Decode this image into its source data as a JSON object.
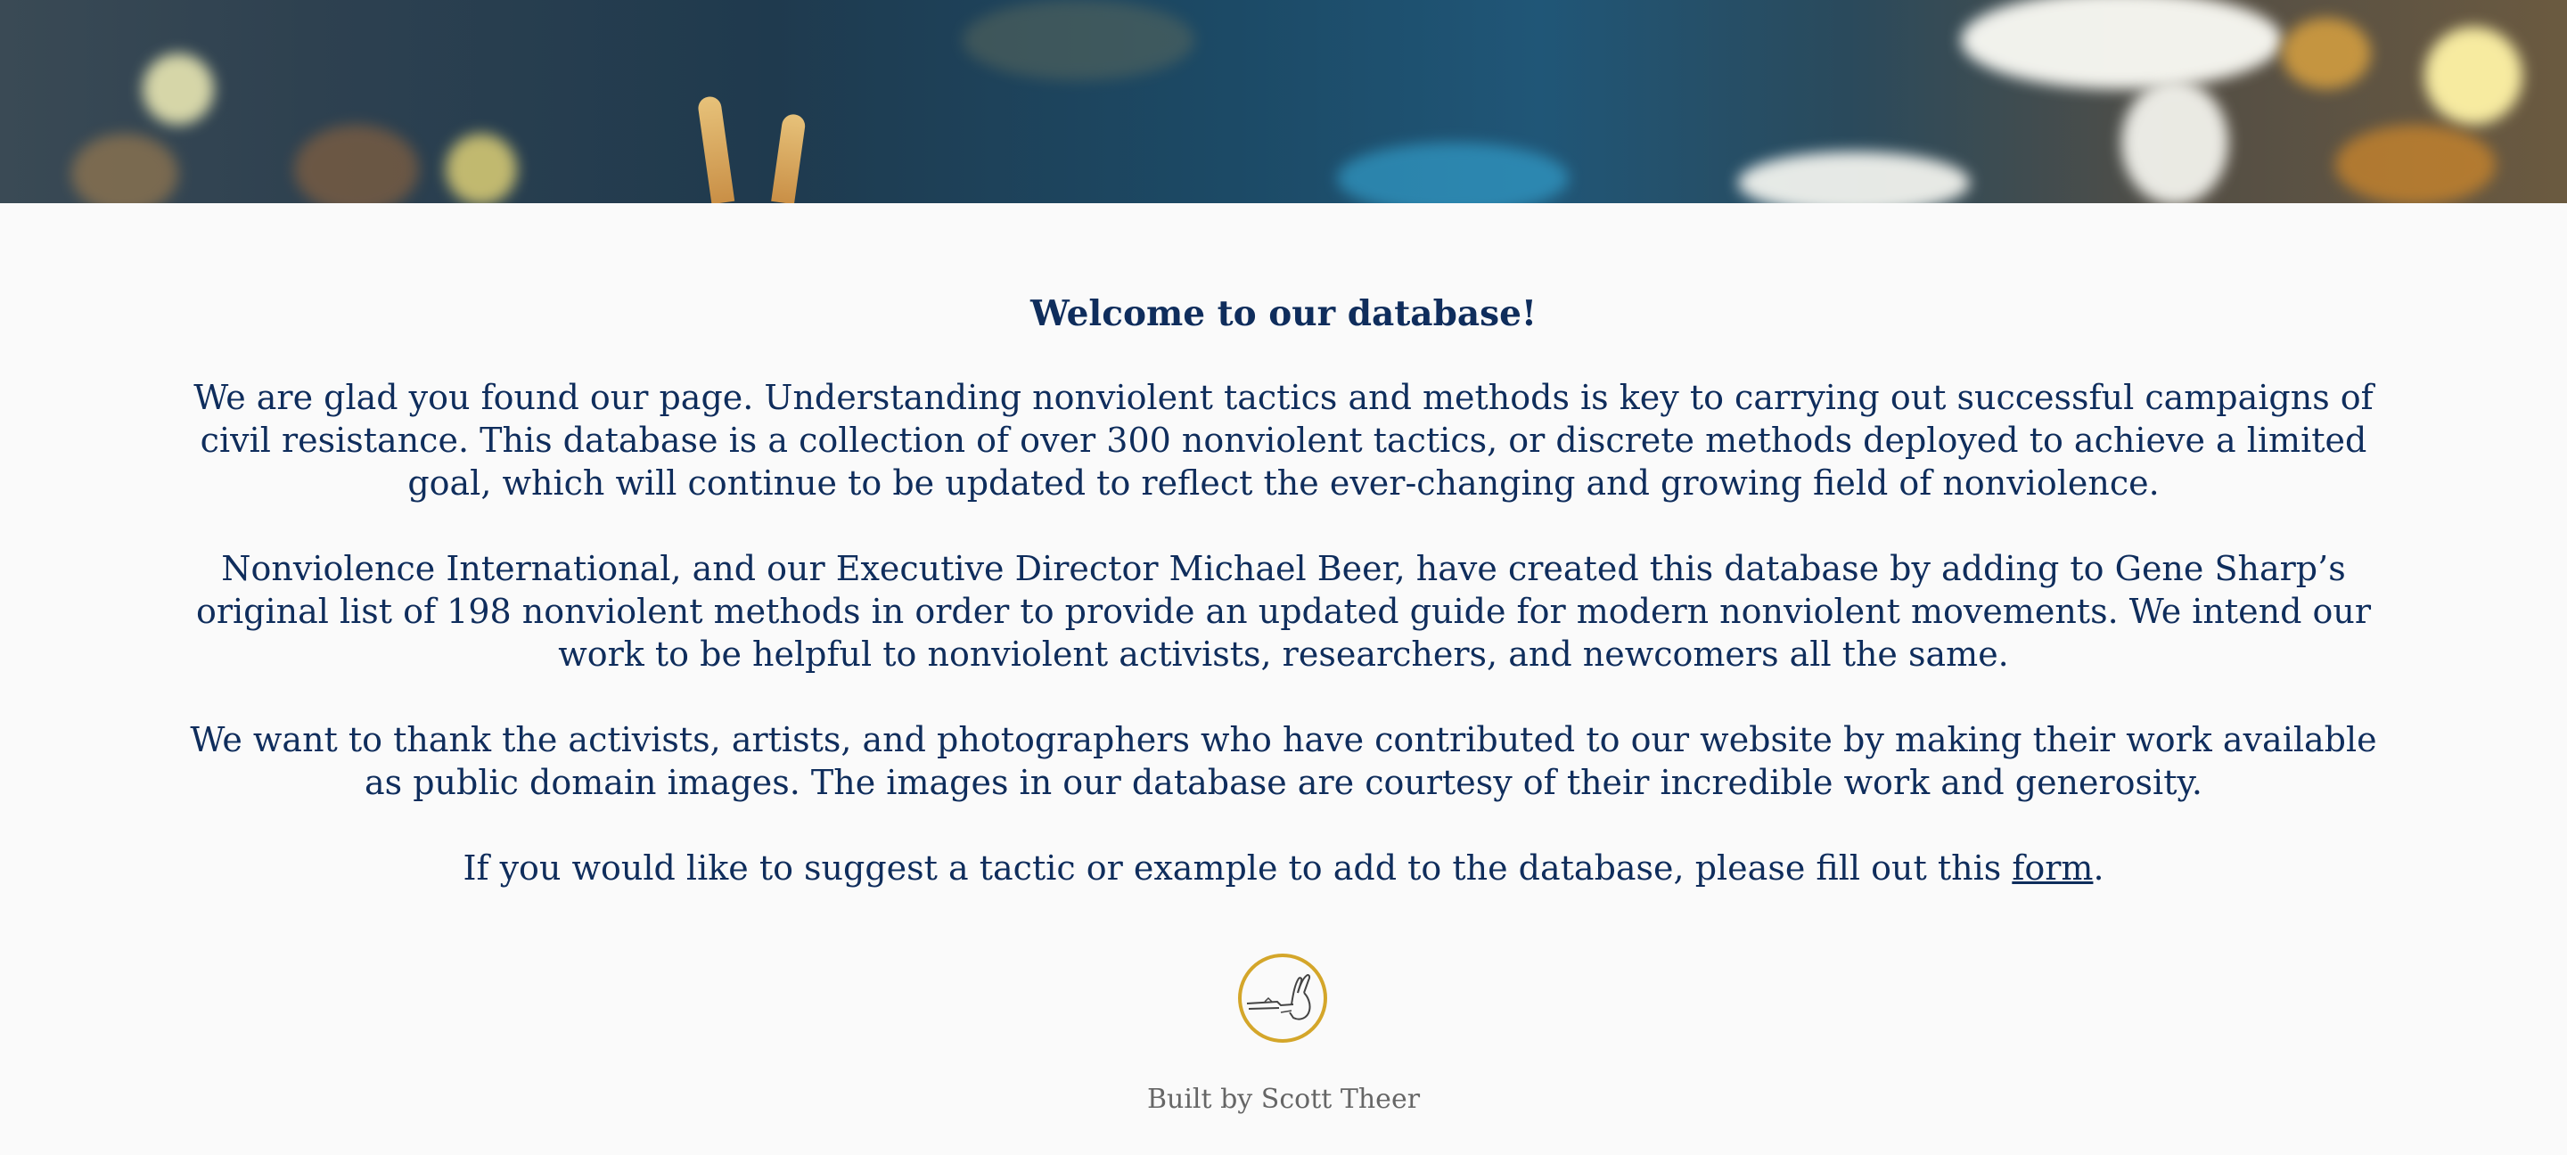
{
  "hero": {
    "description_icon": "peace-sign-hand-icon"
  },
  "main": {
    "heading": "Welcome to our database!",
    "paragraph1": "We are glad you found our page. Understanding nonviolent tactics and methods is key to carrying out successful campaigns of civil resistance. This database is a collection of over 300 nonviolent tactics, or discrete methods deployed to achieve a limited goal, which will continue to be updated to reflect the ever-changing and growing field of nonviolence.",
    "paragraph2": "Nonviolence International, and our Executive Director Michael Beer, have created this database by adding to Gene Sharp’s original list of 198 nonviolent methods in order to provide an updated guide for modern nonviolent movements. We intend our work to be helpful to nonviolent activists, researchers, and newcomers all the same.",
    "paragraph3": "We want to thank the activists, artists, and photographers who have contributed to our website by making their work available as public domain images. The images in our database are courtesy of their incredible work and generosity.",
    "paragraph4_before": "If you would like to suggest a tactic or example to add to the database, please fill out this ",
    "paragraph4_link": "form",
    "paragraph4_after": "."
  },
  "logo": {
    "icon": "nonviolence-logo-icon"
  },
  "footer": {
    "credit": "Built by Scott Theer"
  },
  "colors": {
    "text": "#0f2d5c",
    "logo_ring": "#d4a62a",
    "footer_text": "#666666",
    "background": "#fafafa"
  }
}
